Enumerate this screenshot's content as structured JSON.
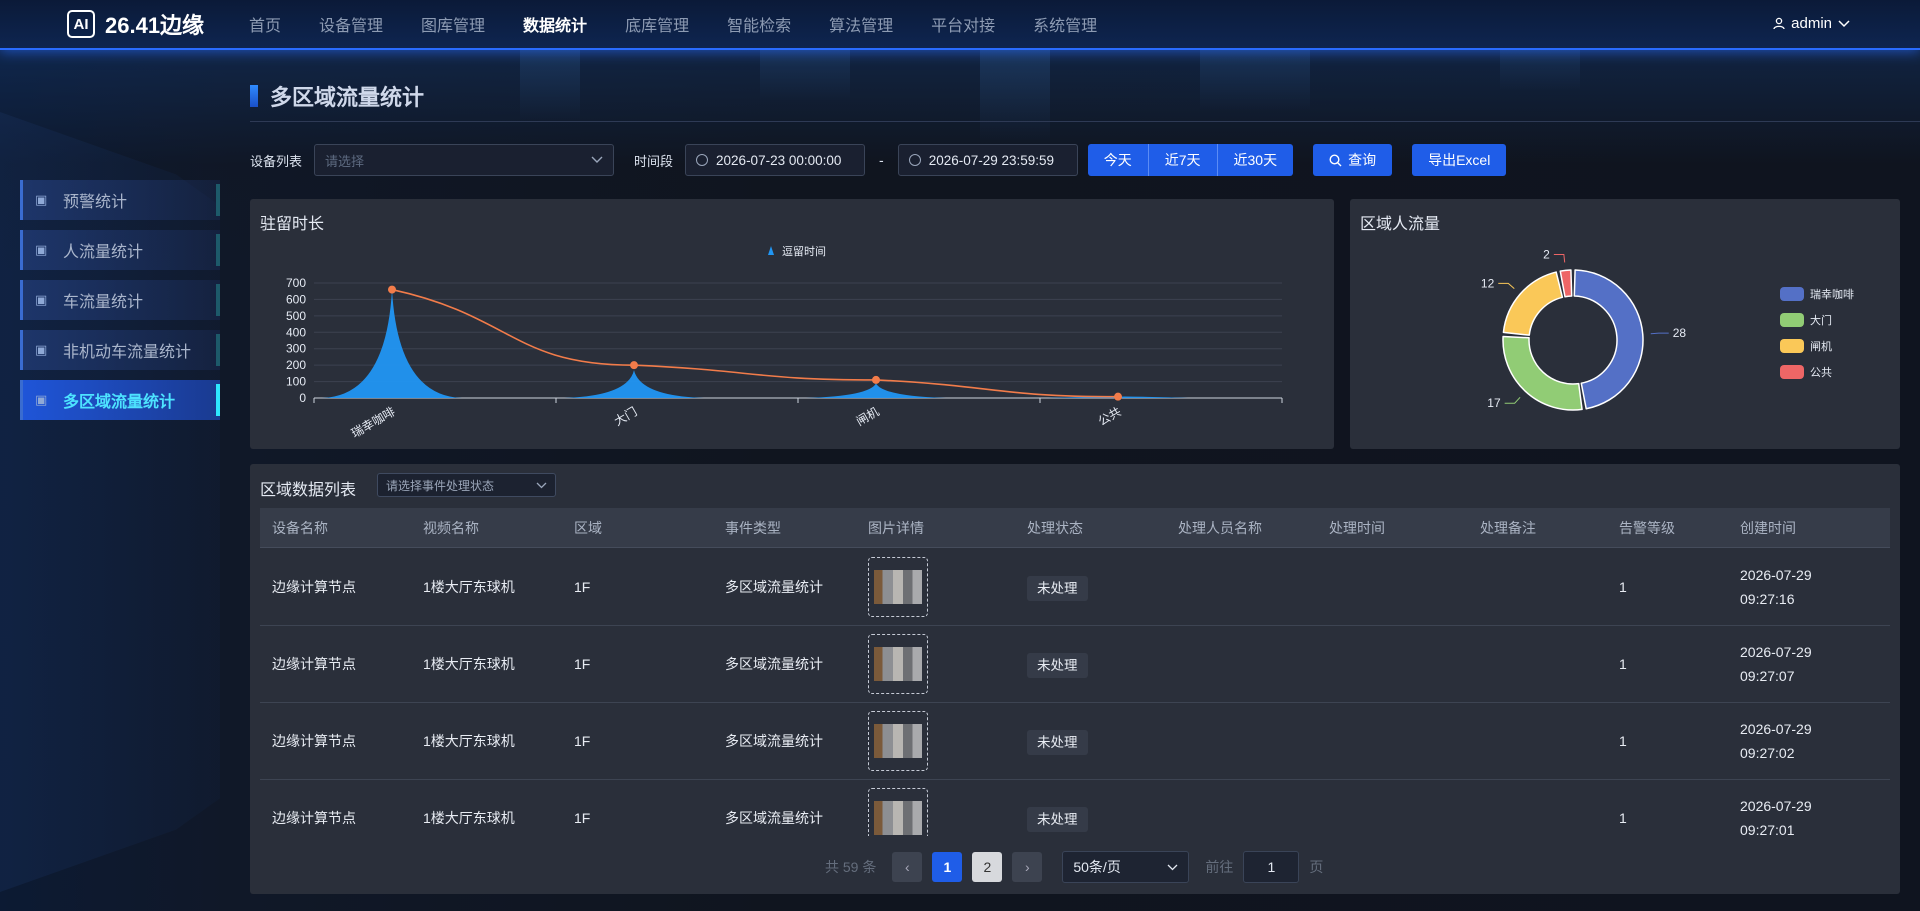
{
  "app": {
    "logo_mark": "AI",
    "title": "26.41边缘"
  },
  "nav": {
    "items": [
      "首页",
      "设备管理",
      "图库管理",
      "数据统计",
      "底库管理",
      "智能检索",
      "算法管理",
      "平台对接",
      "系统管理"
    ],
    "active": "数据统计"
  },
  "user": {
    "name": "admin"
  },
  "sidebar": {
    "items": [
      {
        "label": "预警统计",
        "icon": "chart-box-icon"
      },
      {
        "label": "人流量统计",
        "icon": "chart-box-icon"
      },
      {
        "label": "车流量统计",
        "icon": "chart-box-icon"
      },
      {
        "label": "非机动车流量统计",
        "icon": "chart-box-icon"
      },
      {
        "label": "多区域流量统计",
        "icon": "chart-box-icon"
      }
    ],
    "active": "多区域流量统计"
  },
  "page": {
    "title": "多区域流量统计"
  },
  "filter": {
    "device_label": "设备列表",
    "device_placeholder": "请选择",
    "time_label": "时间段",
    "start": "2026-07-23 00:00:00",
    "end": "2026-07-29 23:59:59",
    "dash": "-",
    "quick": [
      "今天",
      "近7天",
      "近30天"
    ],
    "query": "查询",
    "export": "导出Excel"
  },
  "line_card": {
    "title": "驻留时长"
  },
  "pie_card": {
    "title": "区域人流量"
  },
  "chart_data": [
    {
      "type": "bar",
      "title": "驻留时长",
      "legend": [
        "逗留时间"
      ],
      "categories": [
        "瑞幸咖啡",
        "大门",
        "闸机",
        "公共"
      ],
      "series": [
        {
          "name": "逗留时间",
          "values": [
            660,
            170,
            90,
            8
          ]
        }
      ],
      "trend_line": [
        660,
        200,
        110,
        8
      ],
      "ylim": [
        0,
        700
      ],
      "yticks": [
        0,
        100,
        200,
        300,
        400,
        500,
        600,
        700
      ],
      "grid": true,
      "colors": {
        "bar": "#2196f3",
        "line": "#f27c4a"
      }
    },
    {
      "type": "pie",
      "title": "区域人流量",
      "labels": [
        "瑞幸咖啡",
        "大门",
        "闸机",
        "公共"
      ],
      "values": [
        28,
        17,
        12,
        2
      ],
      "colors": [
        "#5470c6",
        "#91cc75",
        "#fac858",
        "#ee6666"
      ],
      "legend_position": "right"
    }
  ],
  "table": {
    "title": "区域数据列表",
    "status_filter_placeholder": "请选择事件处理状态",
    "columns": [
      "设备名称",
      "视频名称",
      "区域",
      "事件类型",
      "图片详情",
      "处理状态",
      "处理人员名称",
      "处理时间",
      "处理备注",
      "告警等级",
      "创建时间"
    ],
    "rows": [
      {
        "device": "边缘计算节点",
        "video": "1楼大厅东球机",
        "area": "1F",
        "event": "多区域流量统计",
        "status": "未处理",
        "handler": "",
        "handle_time": "",
        "note": "",
        "level": "1",
        "date": "2026-07-29",
        "time": "09:27:16"
      },
      {
        "device": "边缘计算节点",
        "video": "1楼大厅东球机",
        "area": "1F",
        "event": "多区域流量统计",
        "status": "未处理",
        "handler": "",
        "handle_time": "",
        "note": "",
        "level": "1",
        "date": "2026-07-29",
        "time": "09:27:07"
      },
      {
        "device": "边缘计算节点",
        "video": "1楼大厅东球机",
        "area": "1F",
        "event": "多区域流量统计",
        "status": "未处理",
        "handler": "",
        "handle_time": "",
        "note": "",
        "level": "1",
        "date": "2026-07-29",
        "time": "09:27:02"
      },
      {
        "device": "边缘计算节点",
        "video": "1楼大厅东球机",
        "area": "1F",
        "event": "多区域流量统计",
        "status": "未处理",
        "handler": "",
        "handle_time": "",
        "note": "",
        "level": "1",
        "date": "2026-07-29",
        "time": "09:27:01"
      }
    ]
  },
  "pager": {
    "total": "共 59 条",
    "prev": "‹",
    "pages": [
      "1",
      "2"
    ],
    "next": "›",
    "page_size": "50条/页",
    "goto_label": "前往",
    "goto_value": "1",
    "goto_suffix": "页"
  }
}
